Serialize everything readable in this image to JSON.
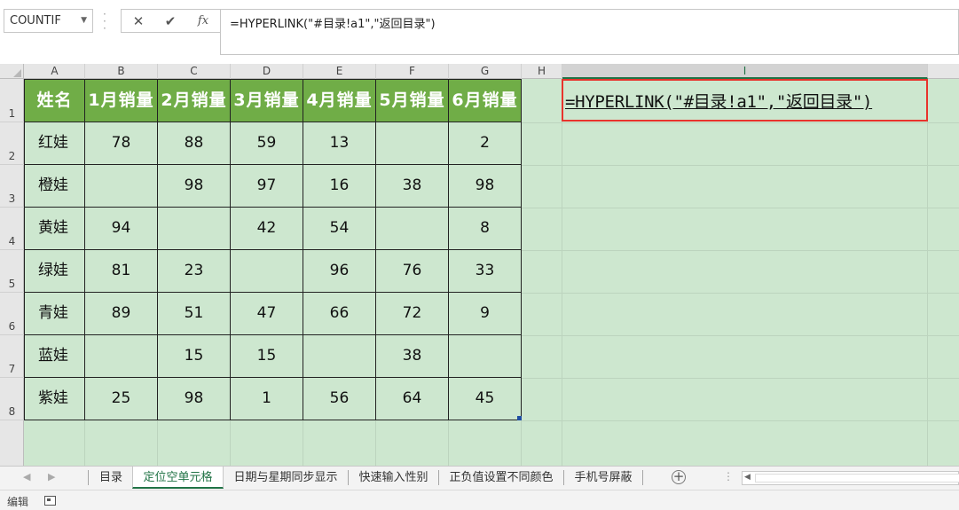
{
  "formula_bar": {
    "name_box": "COUNTIF",
    "cancel_icon": "✕",
    "enter_icon": "✔",
    "fx_label": "fx",
    "formula": "=HYPERLINK(\"#目录!a1\",\"返回目录\")"
  },
  "columns": [
    "A",
    "B",
    "C",
    "D",
    "E",
    "F",
    "G",
    "H",
    "I"
  ],
  "rows": [
    "1",
    "2",
    "3",
    "4",
    "5",
    "6",
    "7",
    "8"
  ],
  "table": {
    "headers": [
      "姓名",
      "1月销量",
      "2月销量",
      "3月销量",
      "4月销量",
      "5月销量",
      "6月销量"
    ],
    "rows": [
      [
        "红娃",
        "78",
        "88",
        "59",
        "13",
        "",
        "2"
      ],
      [
        "橙娃",
        "",
        "98",
        "97",
        "16",
        "38",
        "98"
      ],
      [
        "黄娃",
        "94",
        "",
        "42",
        "54",
        "",
        "8"
      ],
      [
        "绿娃",
        "81",
        "23",
        "",
        "96",
        "76",
        "33"
      ],
      [
        "青娃",
        "89",
        "51",
        "47",
        "66",
        "72",
        "9"
      ],
      [
        "蓝娃",
        "",
        "15",
        "15",
        "",
        "38",
        ""
      ],
      [
        "紫娃",
        "25",
        "98",
        "1",
        "56",
        "64",
        "45"
      ]
    ]
  },
  "active_cell": {
    "ref": "I1",
    "content": "=HYPERLINK(\"#目录!a1\",\"返回目录\")"
  },
  "sheet_tabs": [
    "目录",
    "定位空单元格",
    "日期与星期同步显示",
    "快速输入性别",
    "正负值设置不同颜色",
    "手机号屏蔽"
  ],
  "active_tab": "定位空单元格",
  "status": "编辑",
  "colors": {
    "header_fill": "#70ad47",
    "sheet_bg": "#cde7cf",
    "highlight_border": "#e8332c",
    "accent": "#217346"
  }
}
